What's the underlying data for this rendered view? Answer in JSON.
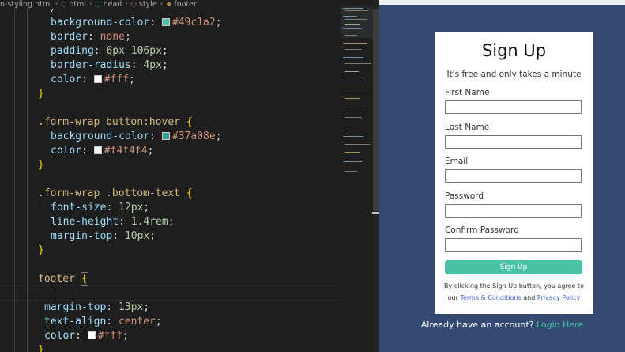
{
  "breadcrumb": {
    "file": "n-styling.html",
    "items": [
      "html",
      "head",
      "style",
      "footer"
    ]
  },
  "code_lines": {
    "l0_prop": "/",
    "l1_prop": "background-color",
    "l1_val": "#49c1a2",
    "l2_prop": "border",
    "l2_val": "none",
    "l3_prop": "padding",
    "l3_val": "6px 106px",
    "l4_prop": "border-radius",
    "l4_val": "4px",
    "l5_prop": "color",
    "l5_val": "#fff",
    "l8_sel": ".form-wrap button:hover",
    "l9_prop": "background-color",
    "l9_val": "#37a08e",
    "l10_prop": "color",
    "l10_val": "#f4f4f4",
    "l13_sel": ".form-wrap .bottom-text",
    "l14_prop": "font-size",
    "l14_val": "12px",
    "l15_prop": "line-height",
    "l15_val": "1.4rem",
    "l16_prop": "margin-top",
    "l16_val": "10px",
    "l19_sel": "footer",
    "l21_prop": "margin-top",
    "l21_val": "13px",
    "l22_prop": "text-align",
    "l22_val": "center",
    "l23_prop": "color",
    "l23_val": "#fff",
    "open_brace": "{",
    "close_brace": "}"
  },
  "swatch_colors": {
    "green": "#49c1a2",
    "white": "#ffffff",
    "dark_green": "#37a08e",
    "light_gray": "#f4f4f4"
  },
  "form": {
    "title": "Sign Up",
    "subtitle": "It's free and only takes a minute",
    "fields": [
      {
        "label": "First Name",
        "value": ""
      },
      {
        "label": "Last Name",
        "value": ""
      },
      {
        "label": "Email",
        "value": ""
      },
      {
        "label": "Password",
        "value": ""
      },
      {
        "label": "Confirm Password",
        "value": ""
      }
    ],
    "button_label": "Sign Up",
    "bottom_text_1": "By clicking the Sign Up button, you agree to",
    "bottom_text_our": "our",
    "terms_link": "Terms & Conditions",
    "and_text": "and",
    "privacy_link": "Privacy Policy"
  },
  "footer": {
    "text": "Already have an account?",
    "link": "Login Here"
  },
  "colors": {
    "preview_bg": "#344a72",
    "accent": "#49c1a2",
    "link": "#3b5bdb"
  }
}
